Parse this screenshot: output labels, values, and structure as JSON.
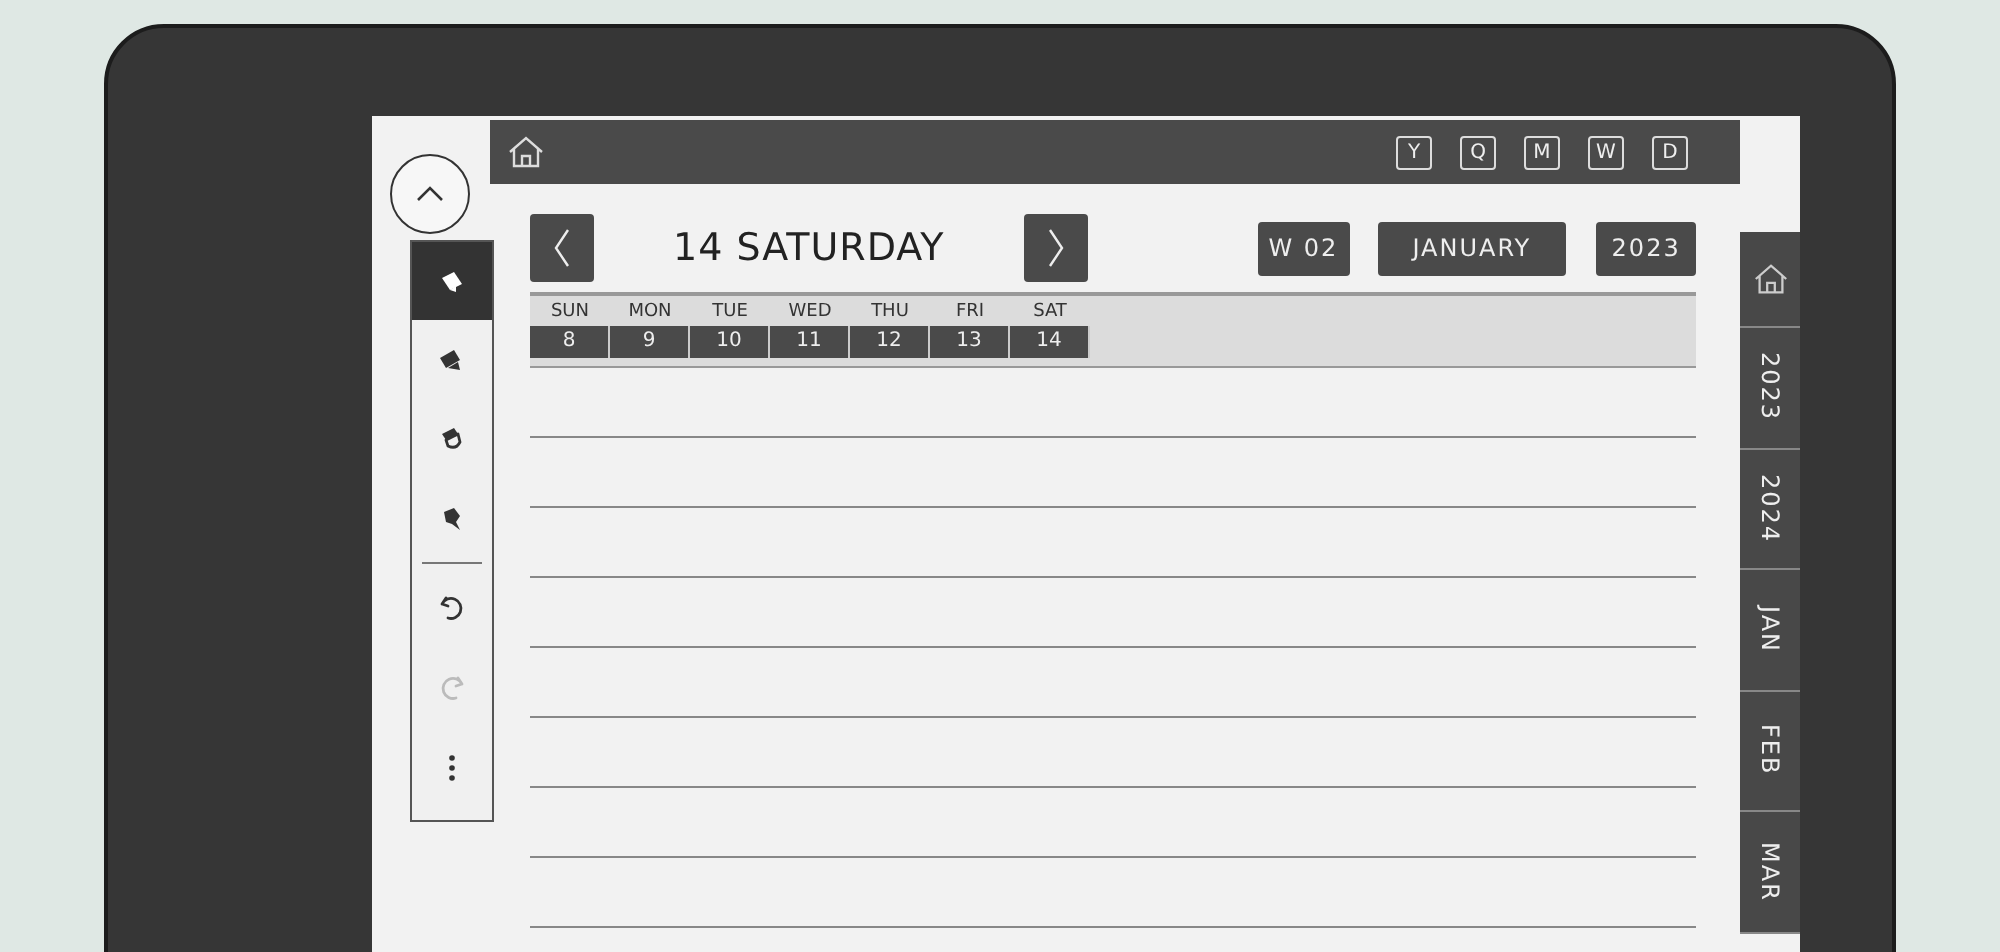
{
  "top_bar": {
    "views": [
      {
        "label": "Y"
      },
      {
        "label": "Q"
      },
      {
        "label": "M"
      },
      {
        "label": "W"
      },
      {
        "label": "D"
      }
    ]
  },
  "toolbar": {
    "tools": [
      {
        "kind": "marker",
        "selected": true
      },
      {
        "kind": "highlighter",
        "selected": false
      },
      {
        "kind": "eraser",
        "selected": false
      },
      {
        "kind": "brush",
        "selected": false
      },
      {
        "kind": "undo",
        "disabled": false
      },
      {
        "kind": "redo",
        "disabled": true
      },
      {
        "kind": "more"
      }
    ]
  },
  "day_header": {
    "title": "14 SATURDAY",
    "week": "W 02",
    "month": "JANUARY",
    "year": "2023"
  },
  "week_strip": [
    {
      "day": "SUN",
      "date": "8"
    },
    {
      "day": "MON",
      "date": "9"
    },
    {
      "day": "TUE",
      "date": "10"
    },
    {
      "day": "WED",
      "date": "11"
    },
    {
      "day": "THU",
      "date": "12"
    },
    {
      "day": "FRI",
      "date": "13"
    },
    {
      "day": "SAT",
      "date": "14"
    }
  ],
  "side_tabs": [
    {
      "kind": "home"
    },
    {
      "kind": "text",
      "label": "2023"
    },
    {
      "kind": "text",
      "label": "2024"
    },
    {
      "kind": "text",
      "label": "JAN"
    },
    {
      "kind": "text",
      "label": "FEB"
    },
    {
      "kind": "text",
      "label": "MAR"
    }
  ]
}
